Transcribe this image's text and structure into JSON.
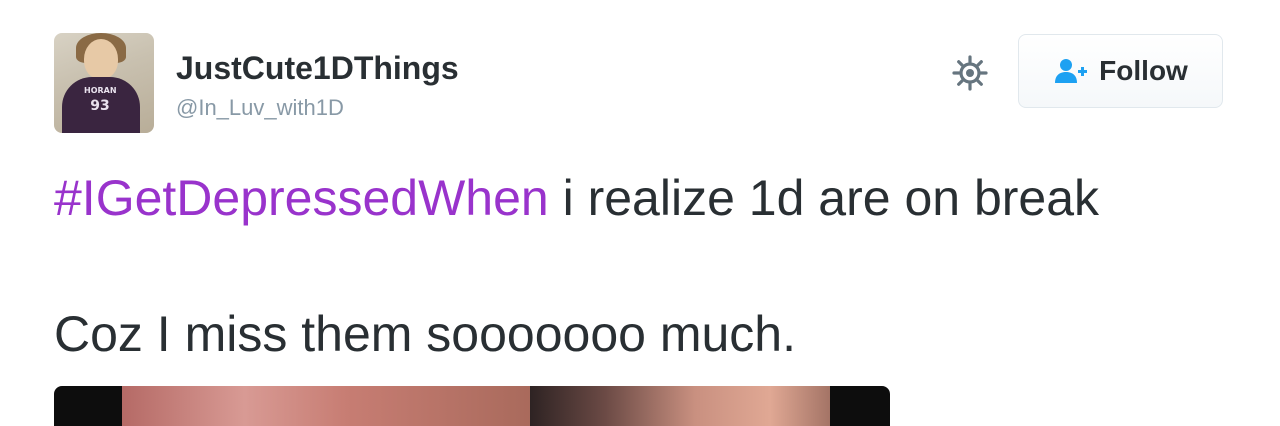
{
  "tweet": {
    "user": {
      "display_name": "JustCute1DThings",
      "screen_name": "@In_Luv_with1D",
      "avatar_shirt_name": "HORAN",
      "avatar_shirt_number": "93"
    },
    "follow_label": "Follow",
    "text_line1": {
      "hashtag": "#IGetDepressedWhen",
      "rest": " i realize 1d are on break"
    },
    "text_line2": "Coz I miss them sooooooo much."
  },
  "colors": {
    "hashtag": "#9933cc",
    "screen_name": "#8899a6",
    "text": "#292f33",
    "follow_icon": "#1da1f2"
  },
  "icons": {
    "settings": "gear-icon",
    "follow": "add-user-icon"
  }
}
